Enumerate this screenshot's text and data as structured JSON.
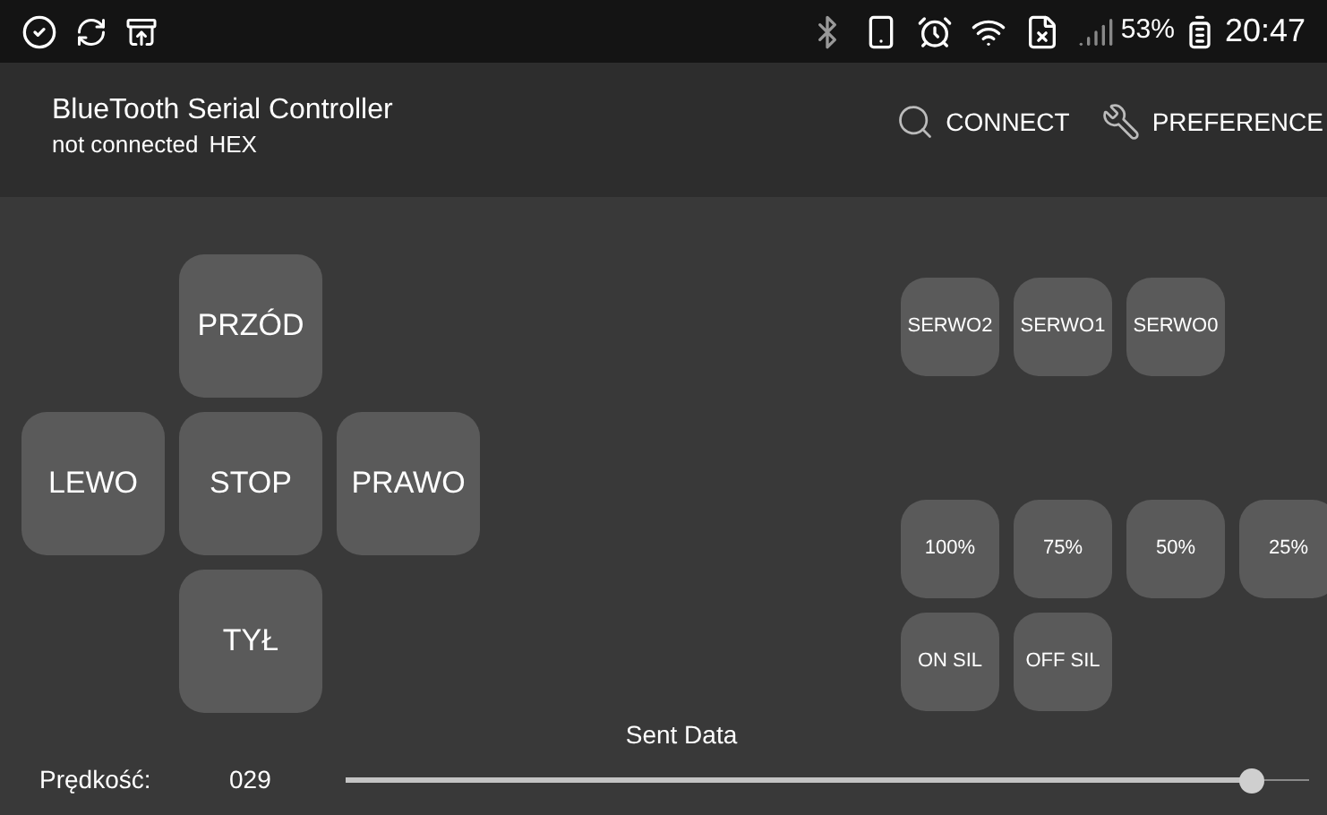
{
  "status_bar": {
    "battery": "53%",
    "time": "20:47"
  },
  "app_bar": {
    "title": "BlueTooth Serial Controller",
    "connection": "not connected",
    "mode": "HEX",
    "actions": [
      {
        "kind": "search",
        "label": "CONNECT"
      },
      {
        "kind": "wrench",
        "label": "PREFERENCE"
      }
    ]
  },
  "dpad": [
    {
      "kind": "empty"
    },
    {
      "kind": "button",
      "label": "PRZÓD"
    },
    {
      "kind": "empty"
    },
    {
      "kind": "button",
      "label": "LEWO"
    },
    {
      "kind": "button",
      "label": "STOP"
    },
    {
      "kind": "button",
      "label": "PRAWO"
    },
    {
      "kind": "empty"
    },
    {
      "kind": "button",
      "label": "TYŁ"
    },
    {
      "kind": "empty"
    }
  ],
  "servo_buttons": [
    "SERWO2",
    "SERWO1",
    "SERWO0"
  ],
  "speed_buttons": [
    "100%",
    "75%",
    "50%",
    "25%"
  ],
  "power_buttons": [
    "ON SIL",
    "OFF SIL"
  ],
  "footer": {
    "sent_data": "Sent Data",
    "speed_label": "Prędkość:",
    "speed_value": "029",
    "slider": {
      "level": 0.94
    }
  }
}
